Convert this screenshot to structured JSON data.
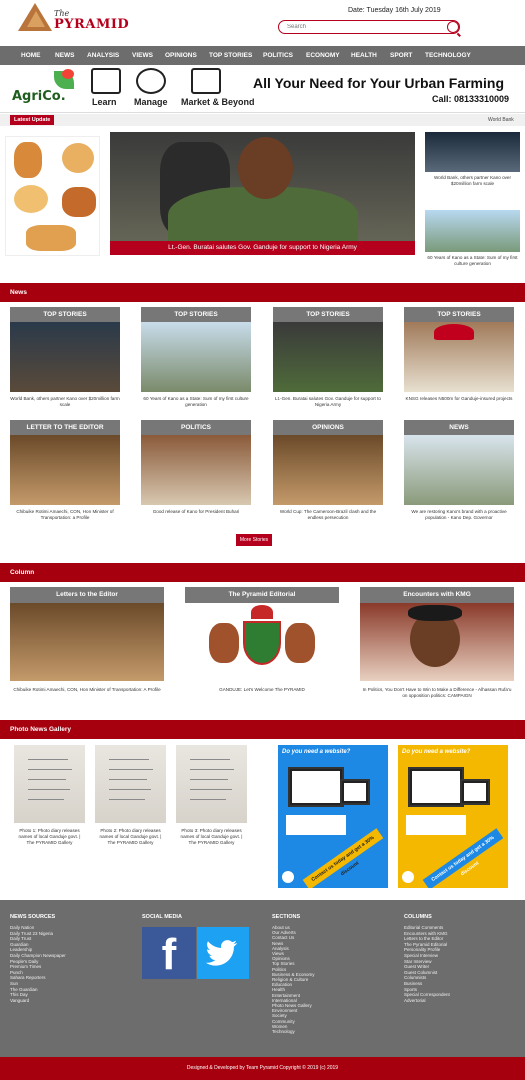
{
  "site": {
    "logo_the": "The",
    "logo_name": "PYRAMID",
    "date": "Date: Tuesday 16th July 2019",
    "search_placeholder": "Search"
  },
  "nav": [
    "HOME",
    "NEWS",
    "ANALYSIS",
    "VIEWS",
    "OPINIONS",
    "TOP STORIES",
    "POLITICS",
    "ECONOMY",
    "HEALTH",
    "SPORT",
    "TECHNOLOGY"
  ],
  "banner": {
    "brand": "AgriCo.",
    "items": [
      "Learn",
      "Manage",
      "Market & Beyond"
    ],
    "title": "All Your Need for Your Urban Farming",
    "phone": "Call: 08133310009"
  },
  "latest": {
    "label": "Latest Update",
    "ticker": "World Bank"
  },
  "hero": {
    "caption": "Lt.-Gen. Buratai salutes Gov. Ganduje for support to Nigeria Army"
  },
  "side_news": [
    {
      "caption": "World Bank, others partner Kano over $20million farm scale"
    },
    {
      "caption": "60 Years of Kano as a State: Sum of my first culture generation"
    }
  ],
  "sections": {
    "news": "News",
    "column": "Column",
    "gallery": "Photo News Gallery"
  },
  "news_cards": [
    {
      "tag": "TOP STORIES",
      "caption": "World Bank, others partner Kano over $20million farm scale"
    },
    {
      "tag": "TOP STORIES",
      "caption": "60 Years of Kano as a State: Sum of my first culture generation"
    },
    {
      "tag": "TOP STORIES",
      "caption": "Lt.-Gen. Buratai salutes Gov. Ganduje for support to Nigeria Army"
    },
    {
      "tag": "TOP STORIES",
      "caption": "KNSG releases N500m for Ganduje-insured projects"
    },
    {
      "tag": "LETTER TO THE EDITOR",
      "caption": "Chibuike Rotimi Amaechi, CON, Hon Minister of Transportation: a Profile"
    },
    {
      "tag": "POLITICS",
      "caption": "Good release of Kano for President Buhari"
    },
    {
      "tag": "OPINIONS",
      "caption": "World Cup: The Cameroon-Brazil clash and the endless persecution"
    },
    {
      "tag": "NEWS",
      "caption": "We are restoring Kano's brand with a proactive population - Kano Dep. Governor"
    }
  ],
  "more_label": "More Stories",
  "column_cards": [
    {
      "tag": "Letters to the Editor",
      "caption": "Chibuike Rotimi Amaechi, CON, Hon Minister of Transportation: A Profile"
    },
    {
      "tag": "The Pyramid Editorial",
      "caption": "GANDUJE: Let's Welcome The PYRAMID"
    },
    {
      "tag": "Encounters with KMG",
      "caption": "In Politics, You Don't Have to Win to Make a Difference - Alhassan Rufa'u on opposition politics: CAMPAIGN"
    }
  ],
  "gallery": [
    {
      "caption": "Photo 1: Photo diary releases names of local Ganduje govt. | The PYRAMID Gallery"
    },
    {
      "caption": "Photo 2: Photo diary releases names of local Ganduje govt. | The PYRAMID Gallery"
    },
    {
      "caption": "Photo 3: Photo diary releases names of local Ganduje govt. | The PYRAMID Gallery"
    }
  ],
  "ads": [
    {
      "headline": "Do you need a website?",
      "cta": "Contact us today and get a 30% discount"
    },
    {
      "headline": "Do you need a website?",
      "cta": "Contact us today and get a 30% discount"
    }
  ],
  "footer": {
    "cols": [
      {
        "title": "News Sources",
        "items": [
          "Daily Nation",
          "Daily Trust 23 Nigeria",
          "Daily Trust",
          "Guardian",
          "Leadership",
          "Daily Champion Newspaper",
          "People's Daily",
          "Premium Times",
          "Punch",
          "Sahara Reporters",
          "Sun",
          "The Guardian",
          "This Day",
          "Vanguard"
        ]
      },
      {
        "title": "Social Media",
        "items": []
      },
      {
        "title": "Sections",
        "items": [
          "About us",
          "Our Adverts",
          "Contact Us",
          "News",
          "Analysis",
          "Views",
          "Opinions",
          "Top Stories",
          "Politics",
          "Business & Economy",
          "Religion & Culture",
          "Education",
          "Health",
          "Entertainment",
          "International",
          "Photo News Gallery",
          "Environment",
          "Society",
          "Community",
          "Women",
          "Technology"
        ]
      },
      {
        "title": "Columns",
        "items": [
          "Editorial Comments",
          "Encounters with KMG",
          "Letters to the Editor",
          "The Pyramid Editorial",
          "Personality Profile",
          "Special Interview",
          "Star Interview",
          "Guest Writer",
          "Guest Columnist",
          "Columnists",
          "Business",
          "Sports",
          "Special Correspondent",
          "Advertorial"
        ]
      }
    ],
    "copyright": "Designed & Developed by Team Pyramid Copyright © 2019 (c) 2019"
  },
  "colors": {
    "brand": "#b5001d",
    "section": "#a6000f",
    "nav": "#6d6d6d"
  }
}
